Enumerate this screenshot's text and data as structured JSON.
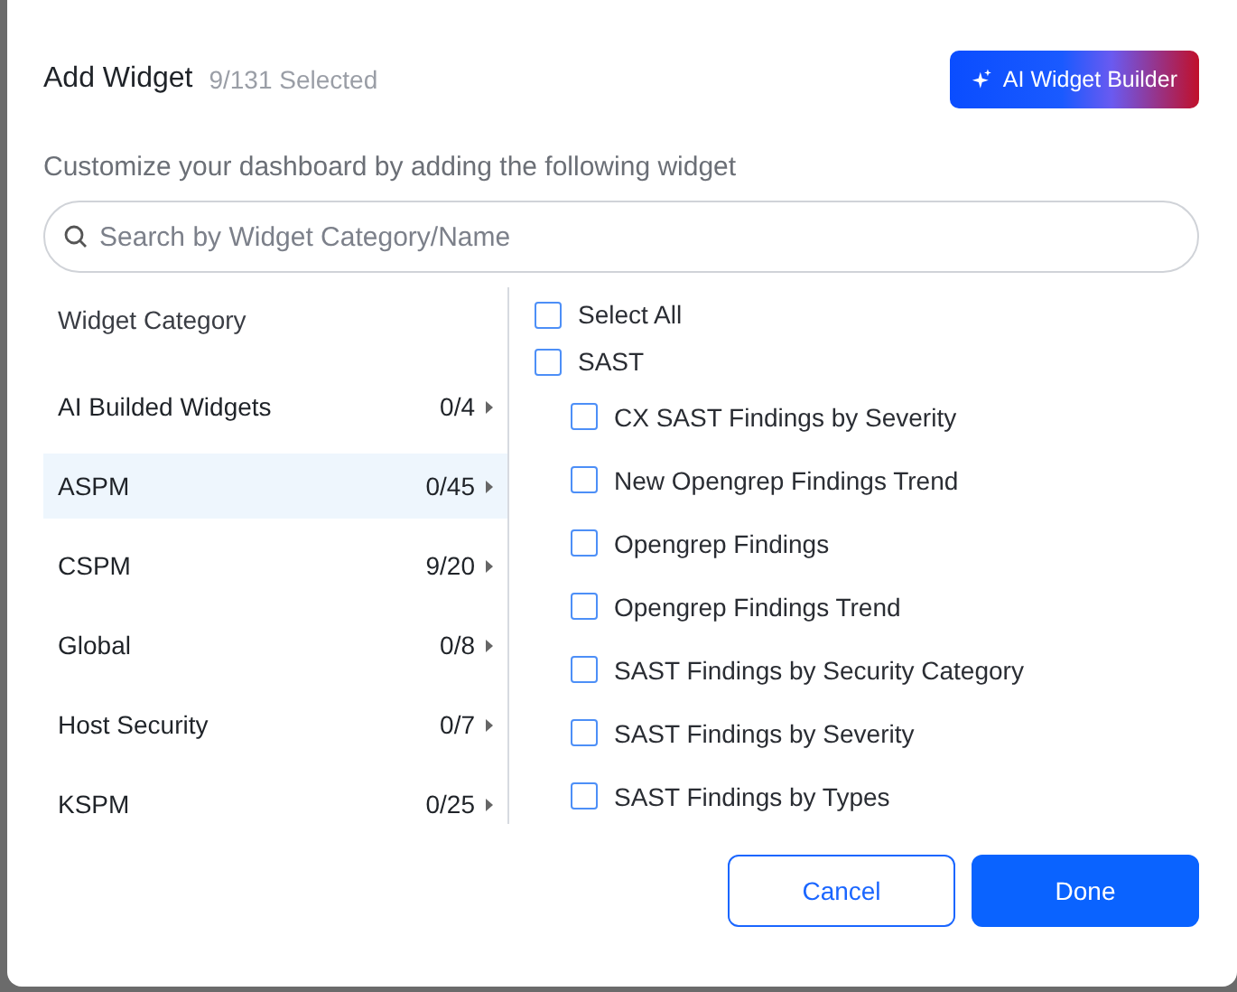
{
  "dialog": {
    "title": "Add Widget",
    "selected_count": "9/131 Selected",
    "ai_button": "AI Widget Builder",
    "description": "Customize your dashboard by adding the following widget",
    "search": {
      "placeholder": "Search by Widget Category/Name"
    }
  },
  "categories": {
    "heading": "Widget Category",
    "items": [
      {
        "name": "AI Builded Widgets",
        "count": "0/4",
        "selected": false
      },
      {
        "name": "ASPM",
        "count": "0/45",
        "selected": true
      },
      {
        "name": "CSPM",
        "count": "9/20",
        "selected": false
      },
      {
        "name": "Global",
        "count": "0/8",
        "selected": false
      },
      {
        "name": "Host Security",
        "count": "0/7",
        "selected": false
      },
      {
        "name": "KSPM",
        "count": "0/25",
        "selected": false
      }
    ]
  },
  "widgets": {
    "select_all": {
      "label": "Select All",
      "checked": false
    },
    "groups": [
      {
        "label": "SAST",
        "checked": false,
        "children": [
          {
            "label": "CX SAST Findings by Severity",
            "checked": false
          },
          {
            "label": "New Opengrep Findings Trend",
            "checked": false
          },
          {
            "label": "Opengrep Findings",
            "checked": false
          },
          {
            "label": "Opengrep Findings Trend",
            "checked": false
          },
          {
            "label": "SAST Findings by Security Category",
            "checked": false
          },
          {
            "label": "SAST Findings by Severity",
            "checked": false
          },
          {
            "label": "SAST Findings by Types",
            "checked": false
          }
        ]
      }
    ]
  },
  "buttons": [
    {
      "label": "Cancel",
      "kind": "secondary"
    },
    {
      "label": "Done",
      "kind": "primary"
    }
  ]
}
